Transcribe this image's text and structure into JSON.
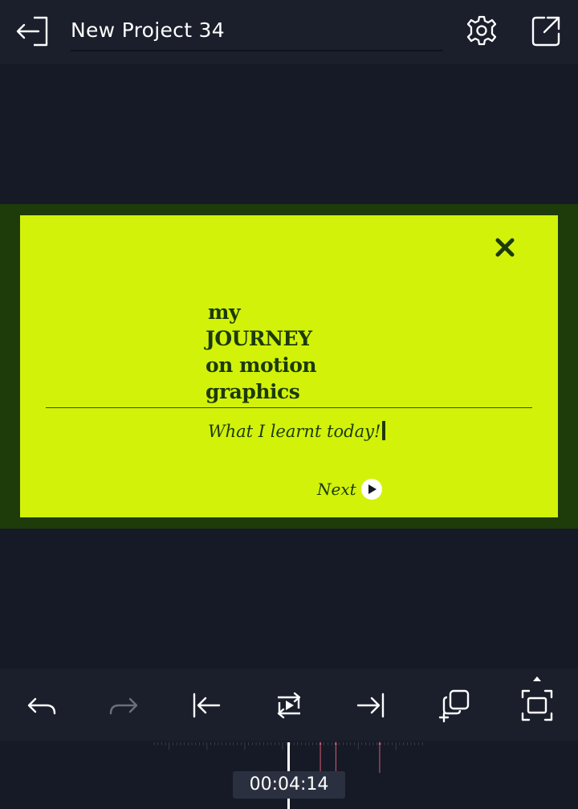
{
  "header": {
    "project_title": "New Project 34",
    "back_icon": "exit-arrow-icon",
    "settings_icon": "gear-icon",
    "share_icon": "external-share-icon"
  },
  "preview": {
    "heading_lines": [
      "my",
      "JOURNEY",
      "on motion",
      "graphics"
    ],
    "subtitle": "What I learnt today!",
    "next_label": "Next",
    "close_icon": "close-x-icon",
    "colors": {
      "stage_bg": "#1e3b0a",
      "card_bg": "#d2f20a",
      "text": "#1c3a0b"
    }
  },
  "toolbar": {
    "items": [
      {
        "icon": "undo-icon"
      },
      {
        "icon": "redo-icon"
      },
      {
        "icon": "jump-to-start-icon"
      },
      {
        "icon": "loop-play-icon"
      },
      {
        "icon": "jump-to-end-icon"
      },
      {
        "icon": "duplicate-icon"
      },
      {
        "icon": "fullscreen-icon"
      }
    ]
  },
  "timeline": {
    "timecode": "00:04:14",
    "marker_color": "#e0607a"
  }
}
